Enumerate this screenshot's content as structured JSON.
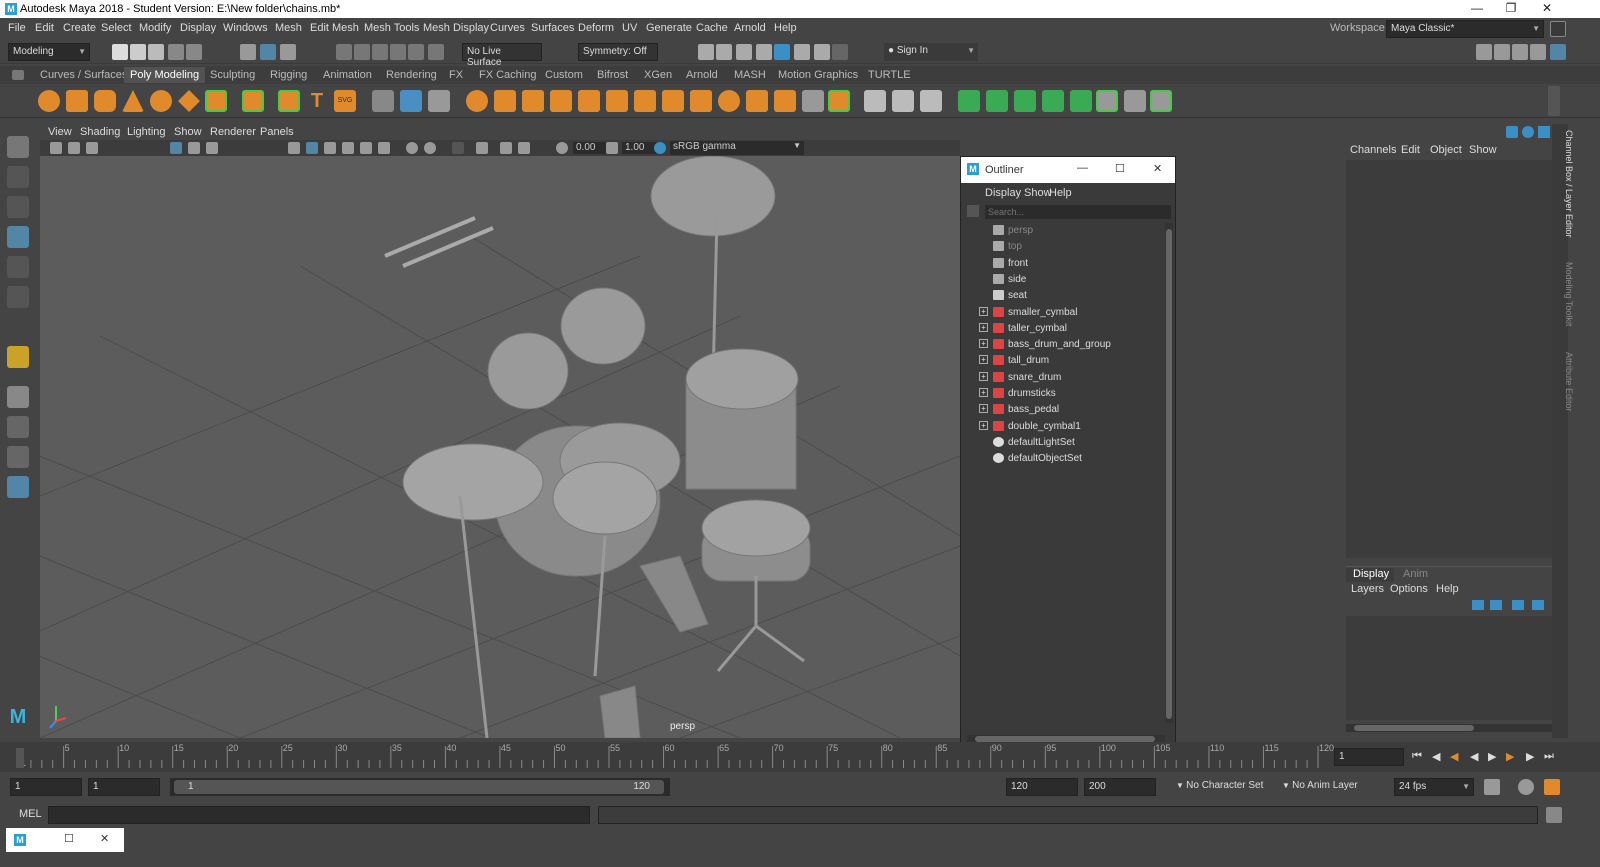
{
  "window": {
    "title": "Autodesk Maya 2018 - Student Version: E:\\New folder\\chains.mb*"
  },
  "menu": [
    "File",
    "Edit",
    "Create",
    "Select",
    "Modify",
    "Display",
    "Windows",
    "Mesh",
    "Edit Mesh",
    "Mesh Tools",
    "Mesh Display",
    "Curves",
    "Surfaces",
    "Deform",
    "UV",
    "Generate",
    "Cache",
    "Arnold",
    "Help"
  ],
  "workspace": {
    "label": "Workspace :",
    "value": "Maya Classic*"
  },
  "statusline": {
    "mode": "Modeling",
    "live_surface": "No Live Surface",
    "symmetry": "Symmetry: Off",
    "sign_in": "Sign In"
  },
  "shelf_tabs": [
    "Curves / Surfaces",
    "Poly Modeling",
    "Sculpting",
    "Rigging",
    "Animation",
    "Rendering",
    "FX",
    "FX Caching",
    "Custom",
    "Bifrost",
    "XGen",
    "Arnold",
    "MASH",
    "Motion Graphics",
    "TURTLE"
  ],
  "viewport": {
    "menu": [
      "View",
      "Shading",
      "Lighting",
      "Show",
      "Renderer",
      "Panels"
    ],
    "exposure": "0.00",
    "gamma": "1.00",
    "colorspace": "sRGB gamma",
    "camera_label": "persp"
  },
  "outliner": {
    "title": "Outliner",
    "menu": [
      "Display",
      "Show",
      "Help"
    ],
    "search_placeholder": "Search...",
    "items": [
      {
        "name": "persp",
        "dim": true,
        "expandable": false,
        "icon": "camera-icon"
      },
      {
        "name": "top",
        "dim": true,
        "expandable": false,
        "icon": "camera-icon"
      },
      {
        "name": "front",
        "dim": false,
        "expandable": false,
        "icon": "camera-icon"
      },
      {
        "name": "side",
        "dim": false,
        "expandable": false,
        "icon": "camera-icon"
      },
      {
        "name": "seat",
        "dim": false,
        "expandable": false,
        "icon": "mesh-icon"
      },
      {
        "name": "smaller_cymbal",
        "dim": false,
        "expandable": true,
        "icon": "group-icon"
      },
      {
        "name": "taller_cymbal",
        "dim": false,
        "expandable": true,
        "icon": "group-icon"
      },
      {
        "name": "bass_drum_and_group",
        "dim": false,
        "expandable": true,
        "icon": "group-icon"
      },
      {
        "name": "tall_drum",
        "dim": false,
        "expandable": true,
        "icon": "group-icon"
      },
      {
        "name": "snare_drum",
        "dim": false,
        "expandable": true,
        "icon": "group-icon"
      },
      {
        "name": "drumsticks",
        "dim": false,
        "expandable": true,
        "icon": "group-icon"
      },
      {
        "name": "bass_pedal",
        "dim": false,
        "expandable": true,
        "icon": "group-icon"
      },
      {
        "name": "double_cymbal1",
        "dim": false,
        "expandable": true,
        "icon": "group-icon"
      },
      {
        "name": "defaultLightSet",
        "dim": false,
        "expandable": false,
        "icon": "set-icon"
      },
      {
        "name": "defaultObjectSet",
        "dim": false,
        "expandable": false,
        "icon": "set-icon"
      }
    ]
  },
  "channel_box": {
    "menu": [
      "Channels",
      "Edit",
      "Object",
      "Show"
    ],
    "side_tabs": [
      "Channel Box / Layer Editor",
      "Modeling Toolkit",
      "Attribute Editor"
    ]
  },
  "layer_editor": {
    "tabs": [
      "Display",
      "Anim"
    ],
    "menu": [
      "Layers",
      "Options",
      "Help"
    ]
  },
  "timeline": {
    "ticks": [
      "1",
      "5",
      "10",
      "15",
      "20",
      "25",
      "30",
      "35",
      "40",
      "45",
      "50",
      "55",
      "60",
      "65",
      "70",
      "75",
      "80",
      "85",
      "90",
      "95",
      "100",
      "105",
      "110",
      "115",
      "120"
    ],
    "current_frame": "1"
  },
  "range": {
    "start": "1",
    "inner_start": "1",
    "slider_start": "1",
    "slider_end": "120",
    "end": "120",
    "anim_end": "200",
    "character_set": "No Character Set",
    "anim_layer": "No Anim Layer",
    "fps": "24 fps"
  },
  "cmdline": {
    "label": "MEL"
  }
}
